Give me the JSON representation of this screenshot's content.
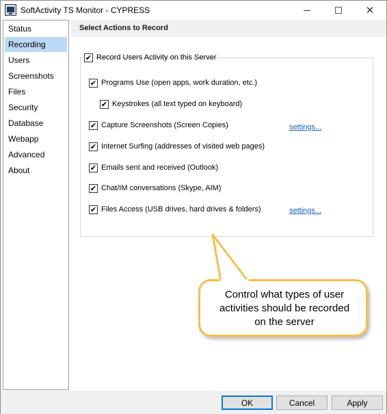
{
  "window": {
    "title": "SoftActivity TS Monitor - CYPRESS",
    "controls": {
      "minimize": "minimize",
      "maximize": "maximize",
      "close": "✕"
    }
  },
  "sidebar": {
    "items": [
      {
        "label": "Status",
        "active": false
      },
      {
        "label": "Recording",
        "active": true
      },
      {
        "label": "Users",
        "active": false
      },
      {
        "label": "Screenshots",
        "active": false
      },
      {
        "label": "Files",
        "active": false
      },
      {
        "label": "Security",
        "active": false
      },
      {
        "label": "Database",
        "active": false
      },
      {
        "label": "Webapp",
        "active": false
      },
      {
        "label": "Advanced",
        "active": false
      },
      {
        "label": "About",
        "active": false
      }
    ]
  },
  "main": {
    "section_title": "Select Actions to Record",
    "record_all": {
      "label": "Record Users Activity on this Server",
      "checked": true
    },
    "options": [
      {
        "label": "Programs Use (open apps, work duration, etc.)",
        "checked": true
      },
      {
        "label": "Keystrokes (all text typed on keyboard)",
        "checked": true
      },
      {
        "label": "Capture Screenshots (Screen Copies)",
        "checked": true
      },
      {
        "label": "Internet Surfing (addresses of visited web pages)",
        "checked": true
      },
      {
        "label": "Emails sent and received (Outlook)",
        "checked": true
      },
      {
        "label": "Chat/IM conversations (Skype, AIM)",
        "checked": true
      },
      {
        "label": "Files Access (USB drives, hard drives & folders)",
        "checked": true
      }
    ],
    "settings_links": {
      "screenshots": "settings...",
      "files": "settings..."
    }
  },
  "callout": {
    "line1": "Control what types of user",
    "line2": "activities should be recorded",
    "line3": "on the server"
  },
  "footer": {
    "ok": "OK",
    "cancel": "Cancel",
    "apply": "Apply"
  },
  "colors": {
    "accent": "#b9d9f7",
    "callout_border": "#f5bf46",
    "link": "#1a5fb4",
    "default_button": "#0078d7"
  },
  "icons": {
    "app": "monitor-icon",
    "check": "checkmark-icon"
  }
}
